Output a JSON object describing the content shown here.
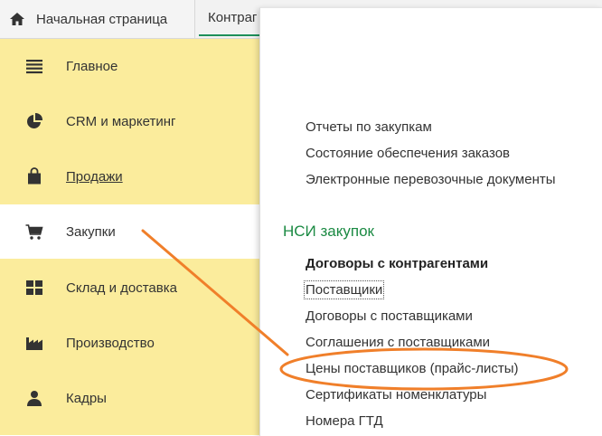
{
  "tabs": {
    "home": {
      "icon": "home-icon",
      "label": "Начальная страница"
    },
    "second": {
      "label": "Контраг"
    }
  },
  "sidebar": {
    "items": [
      {
        "name": "main",
        "icon": "list-icon",
        "label": "Главное",
        "active": false
      },
      {
        "name": "crm",
        "icon": "pie-chart-icon",
        "label": "CRM и маркетинг",
        "active": false
      },
      {
        "name": "sales",
        "icon": "shopping-bag-icon",
        "label": "Продажи",
        "active": false
      },
      {
        "name": "purchases",
        "icon": "cart-icon",
        "label": "Закупки",
        "active": true
      },
      {
        "name": "warehouse",
        "icon": "grid-icon",
        "label": "Склад и доставка",
        "active": false
      },
      {
        "name": "production",
        "icon": "factory-icon",
        "label": "Производство",
        "active": false
      },
      {
        "name": "staff",
        "icon": "person-icon",
        "label": "Кадры",
        "active": false
      }
    ]
  },
  "menu": {
    "reports": [
      "Отчеты по закупкам",
      "Состояние обеспечения заказов",
      "Электронные перевозочные документы"
    ],
    "nsi_title": "НСИ закупок",
    "nsi_items": [
      "Договоры с контрагентами",
      "Поставщики",
      "Договоры с поставщиками",
      "Соглашения с поставщиками",
      "Цены поставщиков (прайс-листы)",
      "Сертификаты номенклатуры",
      "Номера ГТД"
    ]
  },
  "colors": {
    "sidebar_bg": "#fbec9c",
    "section_title": "#1b8a43",
    "annotation": "#f07f2a",
    "tab_underline": "#1e8f5a"
  }
}
